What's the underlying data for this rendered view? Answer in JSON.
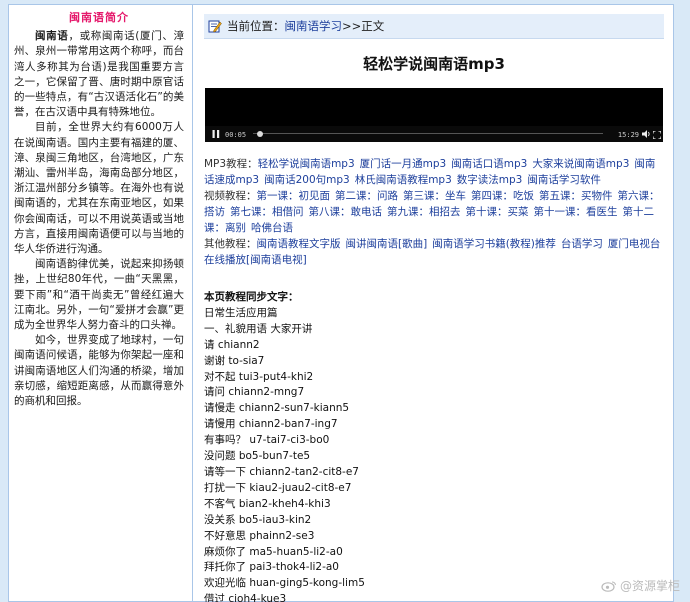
{
  "sidebar": {
    "title": "闽南语简介",
    "paragraphs": [
      {
        "lead": "闽南语",
        "text": "，或称闽南话(厦门、漳州、泉州一带常用这两个称呼，而台湾人多称其为台语)是我国重要方言之一，它保留了晋、唐时期中原官话的一些特点，有“古汉语活化石”的美誉，在古汉语中具有特殊地位。"
      },
      {
        "lead": "",
        "text": "目前，全世界大约有6000万人在说闽南语。国内主要有福建的厦、漳、泉闽三角地区，台湾地区，广东潮汕、雷州半岛，海南岛部分地区，浙江温州部分乡镇等。在海外也有说闽南语的，尤其在东南亚地区，如果你会闽南话，可以不用说英语或当地方言，直接用闽南语便可以与当地的华人华侨进行沟通。"
      },
      {
        "lead": "",
        "text": "闽南语韵律优美，说起来抑扬顿挫，上世纪80年代，一曲“天黑黑，要下雨”和“酒干尚卖无”曾经红遍大江南北。另外，一句“爱拼才会赢”更成为全世界华人努力奋斗的口头禅。"
      },
      {
        "lead": "",
        "text": "如今，世界变成了地球村，一句闽南语问候语，能够为你架起一座和讲闽南语地区人们沟通的桥梁，增加亲切感，缩短距离感，从而赢得意外的商机和回报。"
      }
    ]
  },
  "breadcrumb": {
    "prefix": "当前位置：",
    "link": "闽南语学习",
    "suffix": ">>正文"
  },
  "article": {
    "title": "轻松学说闽南语mp3"
  },
  "player": {
    "current_time": "00:05",
    "total_time": "15:29",
    "progress": 0.02
  },
  "link_groups": [
    {
      "label": "MP3教程：",
      "links": [
        "轻松学说闽南语mp3",
        "厦门话一月通mp3",
        "闽南话口语mp3",
        "大家来说闽南语mp3",
        "闽南话速成mp3",
        "闽南话200句mp3",
        "林氏闽南语教程mp3",
        "数字读法mp3",
        "闽南话学习软件"
      ]
    },
    {
      "label": "视频教程：",
      "links": [
        "第一课：初见面",
        "第二课：问路",
        "第三课：坐车",
        "第四课：吃饭",
        "第五课：买物件",
        "第六课：搭访",
        "第七课：相借问",
        "第八课：敢电话",
        "第九课：相招去",
        "第十课：买菜",
        "第十一课：看医生",
        "第十二课：离别",
        "哈佛台语"
      ]
    },
    {
      "label": "其他教程：",
      "links": [
        "闽南语教程文字版",
        "闽讲闽南语[歌曲]",
        "闽南语学习书籍(教程)推荐",
        "台语学习",
        "厦门电视台在线播放[闽南语电视]"
      ]
    }
  ],
  "content": {
    "heading": "本页教程同步文字：",
    "lines": [
      "日常生活应用篇",
      "一、礼貌用语 大家开讲",
      "请 chiann2",
      "谢谢 to-sia7",
      "对不起 tui3-put4-khi2",
      "请问 chiann2-mng7",
      "请慢走 chiann2-sun7-kiann5",
      "请慢用 chiann2-ban7-ing7",
      "有事吗？ u7-tai7-ci3-bo0",
      "没问题 bo5-bun7-te5",
      "请等一下 chiann2-tan2-cit8-e7",
      "打扰一下 kiau2-juau2-cit8-e7",
      "不客气 bian2-kheh4-khi3",
      "没关系 bo5-iau3-kin2",
      "不好意思 phainn2-se3",
      "麻烦你了 ma5-huan5-li2-a0",
      "拜托你了 pai3-thok4-li2-a0",
      "欢迎光临 huan-ging5-kong-lim5",
      "借过 cioh4-kue3"
    ]
  },
  "watermark": {
    "text": "@资源掌柜"
  }
}
